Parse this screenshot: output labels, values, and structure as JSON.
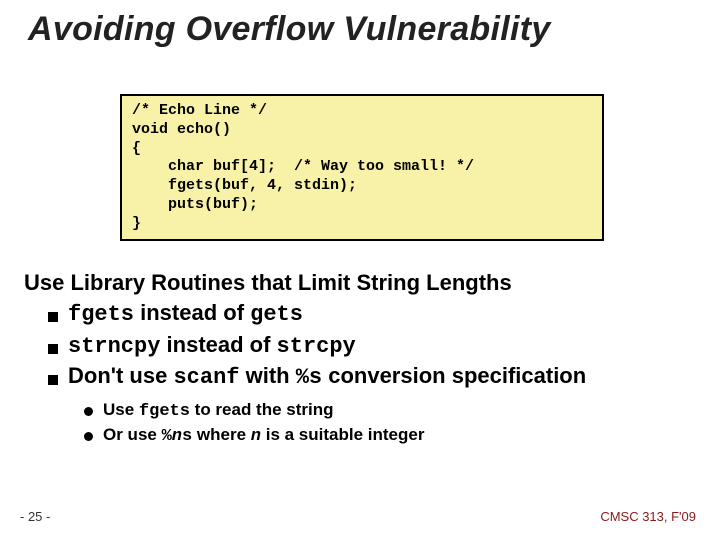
{
  "title": "Avoiding Overflow Vulnerability",
  "code": {
    "l1": "/* Echo Line */",
    "l2": "void echo()",
    "l3": "{",
    "l4": "    char buf[4];  /* Way too small! */",
    "l5": "    fgets(buf, 4, stdin);",
    "l6": "    puts(buf);",
    "l7": "}"
  },
  "section_heading": "Use Library Routines that Limit String Lengths",
  "bullets1": {
    "a_pre": "",
    "a_code1": "fgets",
    "a_mid": " instead of ",
    "a_code2": "gets",
    "b_code1": "strncpy",
    "b_mid": " instead of ",
    "b_code2": "strcpy",
    "c_pre": "Don't use ",
    "c_code1": "scanf",
    "c_mid": " with ",
    "c_code2": "%s",
    "c_post": " conversion specification"
  },
  "bullets2": {
    "a_pre": "Use ",
    "a_code": "fgets",
    "a_post": " to read the string",
    "b_pre": "Or use ",
    "b_code": "%",
    "b_var": "n",
    "b_code2": "s",
    "b_mid": " where ",
    "b_var2": "n",
    "b_post": " is a suitable integer"
  },
  "footer": {
    "left": "- 25 -",
    "right": "CMSC 313, F'09"
  }
}
